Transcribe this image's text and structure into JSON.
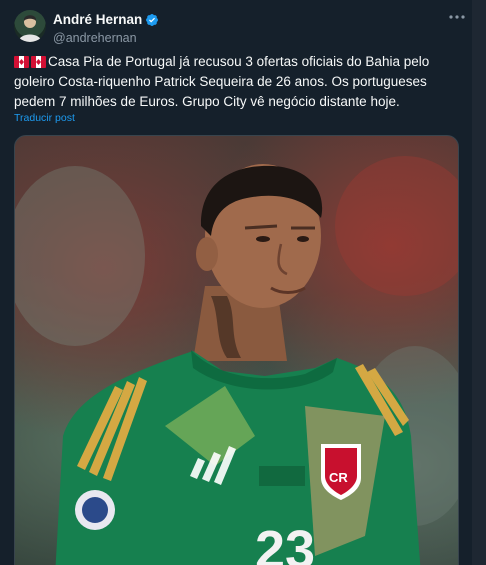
{
  "post": {
    "author": {
      "display_name": "André Hernan",
      "handle": "@andrehernan",
      "verified": true,
      "verified_icon": "verified-badge-icon"
    },
    "more_icon": "more-options-icon",
    "text": "Casa Pia de Portugal já recusou 3 ofertas oficiais do Bahia pelo goleiro Costa-riquenho Patrick Sequeira de 26 anos. Os portugueses pedem 7 milhões de Euros. Grupo City vê negócio distante hoje.",
    "flag_icons": [
      "costa-rica-flag-icon",
      "costa-rica-flag-icon"
    ],
    "translate_label": "Traducir post",
    "media": {
      "jersey_number": "23",
      "crest_letters": "CR"
    }
  },
  "colors": {
    "background": "#15202b",
    "text": "#f7f9f9",
    "secondary_text": "#8b98a5",
    "link": "#1d9bf0",
    "verified": "#1d9bf0"
  }
}
